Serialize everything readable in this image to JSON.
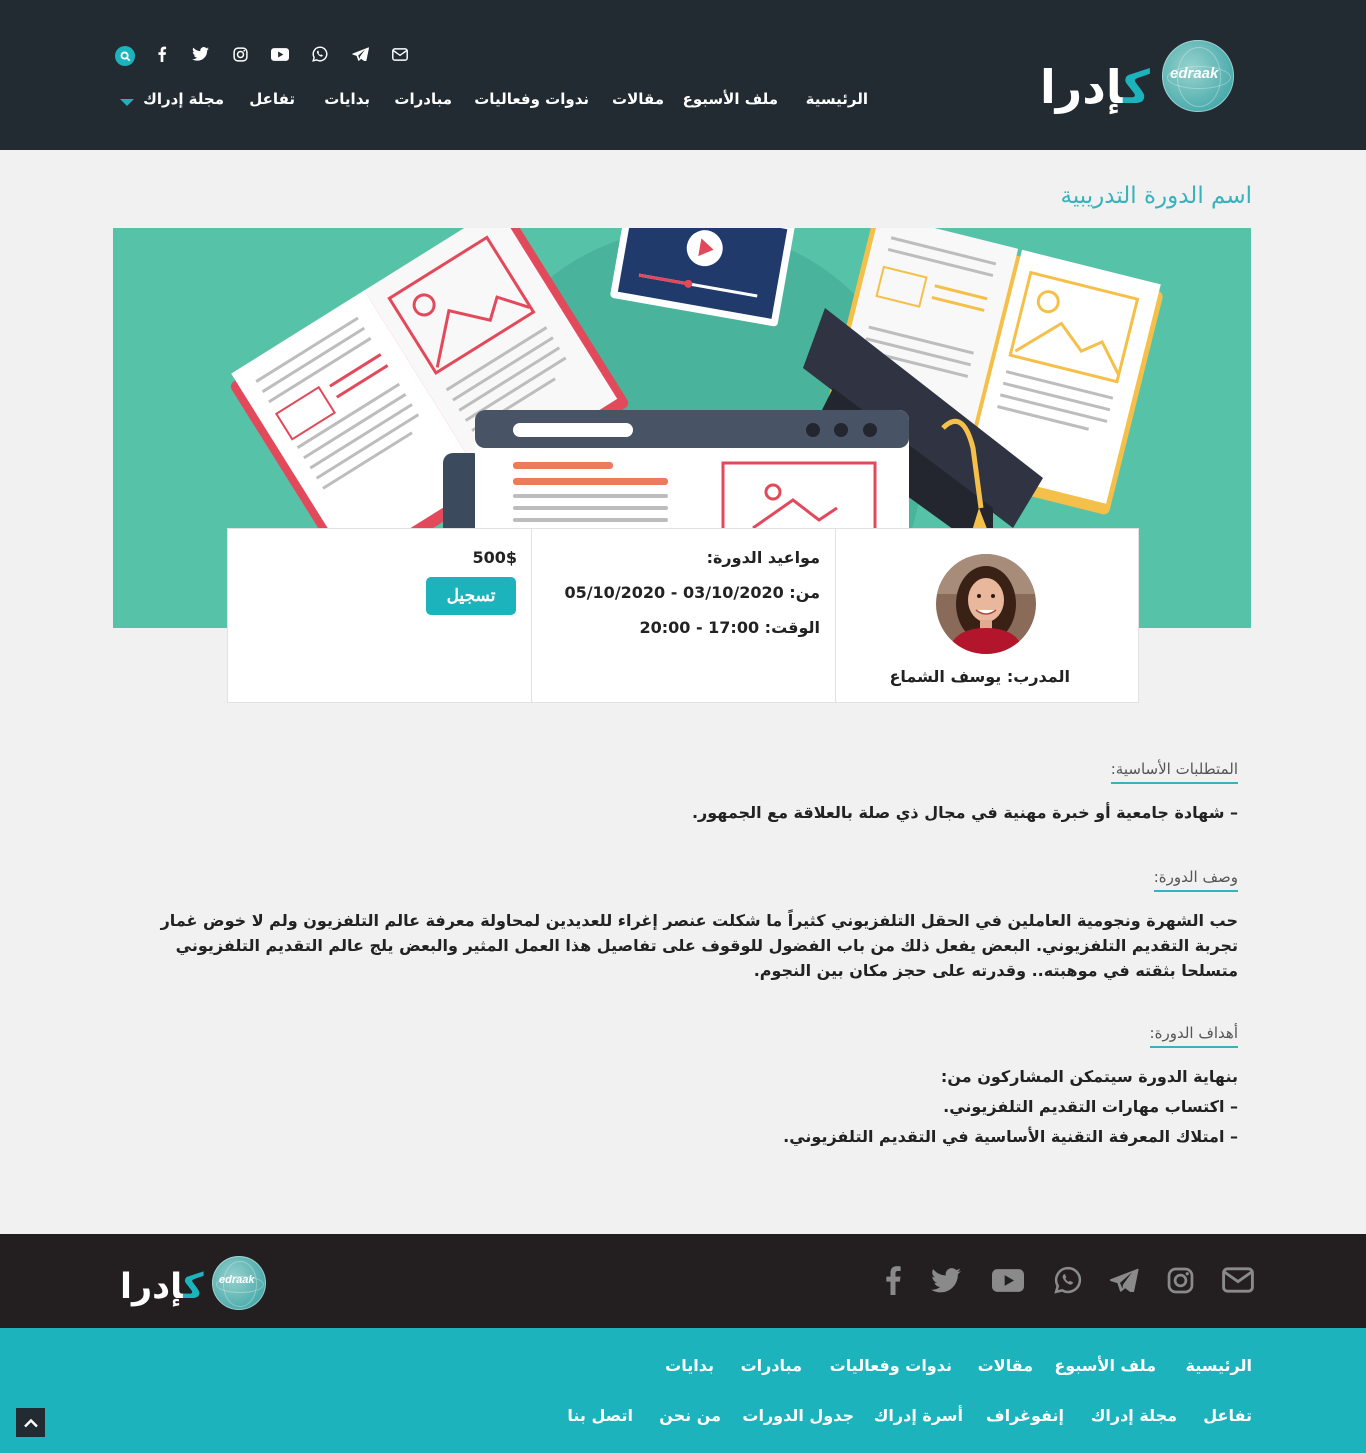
{
  "brand": {
    "arabic": "إدرا",
    "arabic_k": "ك",
    "latin": "edraak"
  },
  "header": {
    "social": [
      "search-icon",
      "facebook-icon",
      "twitter-icon",
      "instagram-icon",
      "youtube-icon",
      "whatsapp-icon",
      "telegram-icon",
      "email-icon"
    ],
    "nav": {
      "home": "الرئيسية",
      "week_file": "ملف الأسبوع",
      "articles": "مقالات",
      "seminars": "ندوات وفعاليات",
      "initiatives": "مبادرات",
      "beginnings": "بدايات",
      "interaction": "تفاعل",
      "magazine": "مجلة إدراك"
    }
  },
  "course": {
    "title": "اسم الدورة التدريبية",
    "trainer": "المدرب: يوسف الشماع",
    "dates_label": "مواعيد الدورة:",
    "dates_range": "من: 03/10/2020 - 05/10/2020",
    "dates_time": "الوقت: 17:00 - 20:00",
    "price": "500$",
    "register": "تسجيل"
  },
  "requirements": {
    "heading": "المتطلبات الأساسية:",
    "item": "–  شهادة جامعية أو خبرة مهنية في مجال ذي صلة بالعلاقة مع الجمهور."
  },
  "description": {
    "heading": "وصف الدورة:",
    "text": "حب الشهرة ونجومية العاملين في الحقل التلفزيوني كثيراً ما شكلت عنصر إغراء للعديدين لمحاولة معرفة عالم التلفزيون ولم لا خوض غمار تجربة التقديم التلفزيوني. البعض يفعل ذلك من باب الفضول للوقوف على تفاصيل هذا العمل المثير والبعض يلج عالم التقديم التلفزيوني متسلحا بثقته في موهبته.. وقدرته على حجز مكان بين النجوم."
  },
  "goals": {
    "heading": "أهداف الدورة:",
    "intro": "بنهاية الدورة سيتمكن المشاركون من:",
    "item1": "– اكتساب مهارات التقديم التلفزيوني.",
    "item2": "– امتلاك المعرفة التقنية الأساسية في التقديم التلفزيوني."
  },
  "footer": {
    "social": [
      "email-icon",
      "instagram-icon",
      "telegram-icon",
      "whatsapp-icon",
      "youtube-icon",
      "twitter-icon",
      "facebook-icon"
    ],
    "row1": {
      "home": "الرئيسية",
      "week_file": "ملف الأسبوع",
      "articles": "مقالات",
      "seminars": "ندوات وفعاليات",
      "initiatives": "مبادرات",
      "beginnings": "بدايات"
    },
    "row2": {
      "interaction": "تفاعل",
      "magazine": "مجلة إدراك",
      "infographic": "إنفوغراف",
      "family": "أسرة إدراك",
      "schedule": "جدول الدورات",
      "about": "من نحن",
      "contact": "اتصل بنا"
    }
  },
  "colors": {
    "header_bg": "#222b32",
    "accent": "#1db3bd",
    "hero_bg": "#56c2a8",
    "footer_dark": "#231f20"
  }
}
